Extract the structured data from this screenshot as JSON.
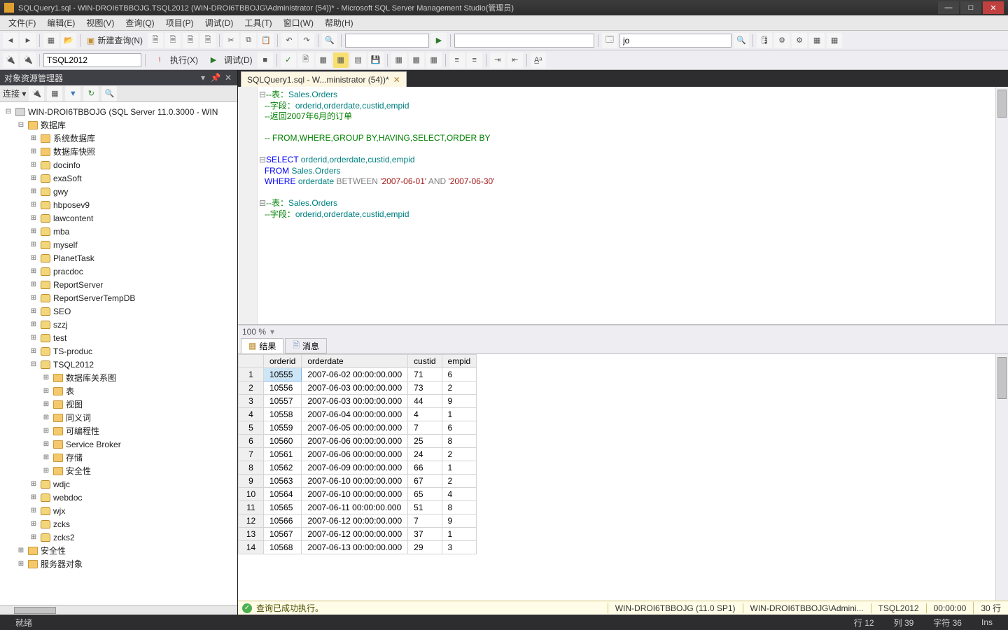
{
  "title": "SQLQuery1.sql - WIN-DROI6TBBOJG.TSQL2012 (WIN-DROI6TBBOJG\\Administrator (54))* - Microsoft SQL Server Management Studio(管理员)",
  "menu": [
    "文件(F)",
    "编辑(E)",
    "视图(V)",
    "查询(Q)",
    "项目(P)",
    "调试(D)",
    "工具(T)",
    "窗口(W)",
    "帮助(H)"
  ],
  "toolbar1": {
    "newquery": "新建查询(N)",
    "search_value": "jo"
  },
  "toolbar2": {
    "db_combo": "TSQL2012",
    "execute": "执行(X)",
    "debug": "调试(D)"
  },
  "sidebar": {
    "title": "对象资源管理器",
    "connect": "连接 ▾",
    "server": "WIN-DROI6TBBOJG (SQL Server 11.0.3000 - WIN",
    "db_root": "数据库",
    "sys_items": [
      "系统数据库",
      "数据库快照"
    ],
    "dbs": [
      "docinfo",
      "exaSoft",
      "gwy",
      "hbposev9",
      "lawcontent",
      "mba",
      "myself",
      "PlanetTask",
      "pracdoc",
      "ReportServer",
      "ReportServerTempDB",
      "SEO",
      "szzj",
      "test",
      "TS-produc"
    ],
    "tsql": "TSQL2012",
    "tsql_children": [
      "数据库关系图",
      "表",
      "视图",
      "同义词",
      "可编程性",
      "Service Broker",
      "存储",
      "安全性"
    ],
    "dbs_after": [
      "wdjc",
      "webdoc",
      "wjx",
      "zcks",
      "zcks2"
    ],
    "root_after": [
      "安全性",
      "服务器对象"
    ]
  },
  "tab": {
    "label": "SQLQuery1.sql - W...ministrator (54))*"
  },
  "sql": {
    "l1a": "--表：",
    "l1b": "Sales.Orders",
    "l2a": "--字段：",
    "l2b": "orderid,orderdate,custid,empid",
    "l3": "--返回2007年6月的订单",
    "l4": "-- FROM,WHERE,GROUP BY,HAVING,SELECT,ORDER BY",
    "kw_select": "SELECT",
    "sel_cols": " orderid,orderdate,custid,empid",
    "kw_from": "FROM",
    "from_tbl": " Sales.Orders",
    "kw_where": "WHERE",
    "where_col": " orderdate ",
    "kw_between": "BETWEEN ",
    "str1": "'2007-06-01'",
    "kw_and": " AND ",
    "str2": "'2007-06-30'",
    "l8a": "--表：",
    "l8b": "Sales.Orders",
    "l9a": "--字段：",
    "l9b": "orderid,orderdate,custid,empid"
  },
  "zoom": "100 %",
  "results": {
    "tab_result": "结果",
    "tab_msg": "消息",
    "cols": [
      "orderid",
      "orderdate",
      "custid",
      "empid"
    ],
    "rows": [
      [
        "10555",
        "2007-06-02 00:00:00.000",
        "71",
        "6"
      ],
      [
        "10556",
        "2007-06-03 00:00:00.000",
        "73",
        "2"
      ],
      [
        "10557",
        "2007-06-03 00:00:00.000",
        "44",
        "9"
      ],
      [
        "10558",
        "2007-06-04 00:00:00.000",
        "4",
        "1"
      ],
      [
        "10559",
        "2007-06-05 00:00:00.000",
        "7",
        "6"
      ],
      [
        "10560",
        "2007-06-06 00:00:00.000",
        "25",
        "8"
      ],
      [
        "10561",
        "2007-06-06 00:00:00.000",
        "24",
        "2"
      ],
      [
        "10562",
        "2007-06-09 00:00:00.000",
        "66",
        "1"
      ],
      [
        "10563",
        "2007-06-10 00:00:00.000",
        "67",
        "2"
      ],
      [
        "10564",
        "2007-06-10 00:00:00.000",
        "65",
        "4"
      ],
      [
        "10565",
        "2007-06-11 00:00:00.000",
        "51",
        "8"
      ],
      [
        "10566",
        "2007-06-12 00:00:00.000",
        "7",
        "9"
      ],
      [
        "10567",
        "2007-06-12 00:00:00.000",
        "37",
        "1"
      ],
      [
        "10568",
        "2007-06-13 00:00:00.000",
        "29",
        "3"
      ]
    ]
  },
  "qstatus": {
    "msg": "查询已成功执行。",
    "server": "WIN-DROI6TBBOJG (11.0 SP1)",
    "user": "WIN-DROI6TBBOJG\\Admini...",
    "db": "TSQL2012",
    "time": "00:00:00",
    "rows": "30 行"
  },
  "status": {
    "ready": "就绪",
    "line": "行 12",
    "col": "列 39",
    "ch": "字符 36",
    "ins": "Ins"
  }
}
